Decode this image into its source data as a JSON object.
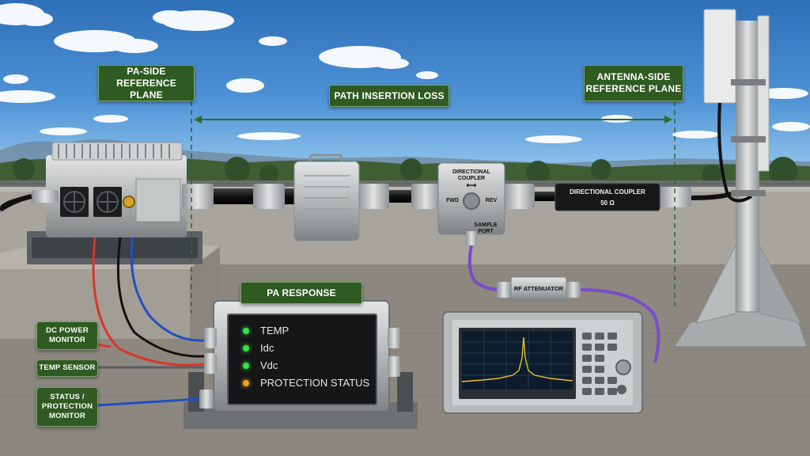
{
  "callouts": {
    "pa_side_reference_plane": "PA-SIDE\nREFERENCE PLANE",
    "path_insertion_loss": "PATH INSERTION LOSS",
    "antenna_side_reference_plane": "ANTENNA-SIDE\nREFERENCE PLANE",
    "pa_response": "PA RESPONSE",
    "dc_power_monitor": "DC POWER\nMONITOR",
    "temp_sensor": "TEMP SENSOR",
    "status_protection_monitor": "STATUS /\nPROTECTION\nMONITOR"
  },
  "status_panel": {
    "items": [
      {
        "label": "TEMP",
        "led": "green"
      },
      {
        "label": "Idc",
        "led": "green"
      },
      {
        "label": "Vdc",
        "led": "green"
      },
      {
        "label": "PROTECTION STATUS",
        "led": "amber"
      }
    ]
  },
  "devices": {
    "directional_coupler_box": {
      "title": "DIRECTIONAL\nCOUPLER",
      "fwd": "FWD",
      "rev": "REV",
      "sample_port": "SAMPLE\nPORT"
    },
    "directional_coupler_inline": {
      "title": "DIRECTIONAL COUPLER",
      "impedance": "50 Ω"
    },
    "rf_attenuator": "RF ATTENUATOR"
  },
  "colors": {
    "callout_bg": "#2f5a22",
    "dashed_guide": "#2f6b2a",
    "cable_red": "#d9352a",
    "cable_blue": "#1f4fc4",
    "cable_purple": "#7a4cc8",
    "led_green": "#38e04a",
    "led_amber": "#f3a516"
  },
  "icons": [
    "fan-icon",
    "arrow-double-icon",
    "spectrum-peak-icon"
  ]
}
